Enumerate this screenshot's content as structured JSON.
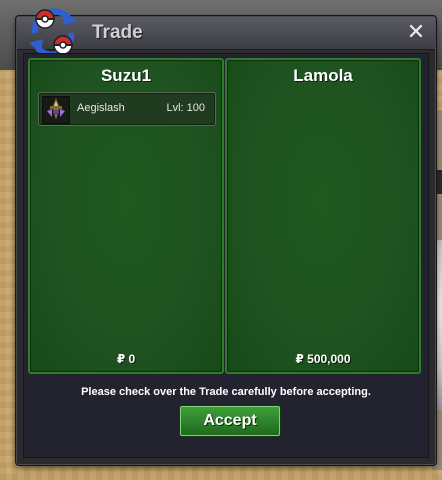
{
  "window": {
    "title": "Trade",
    "close_label": "✕",
    "notice": "Please check over the Trade carefully before accepting.",
    "accept_label": "Accept"
  },
  "left_panel": {
    "player": "Suzu1",
    "money": "₽ 0",
    "items": [
      {
        "name": "Aegislash",
        "level": "Lvl: 100"
      }
    ]
  },
  "right_panel": {
    "player": "Lamola",
    "money": "₽ 500,000",
    "items": []
  },
  "colors": {
    "panel_green": "#1f5a1f",
    "panel_border": "#2f7c2a",
    "accept_green": "#2f8a2c",
    "window_bg": "#2b2b2e"
  },
  "icons": {
    "emblem": "pokeball-swap-icon",
    "sprite": "aegislash-sprite-icon"
  }
}
